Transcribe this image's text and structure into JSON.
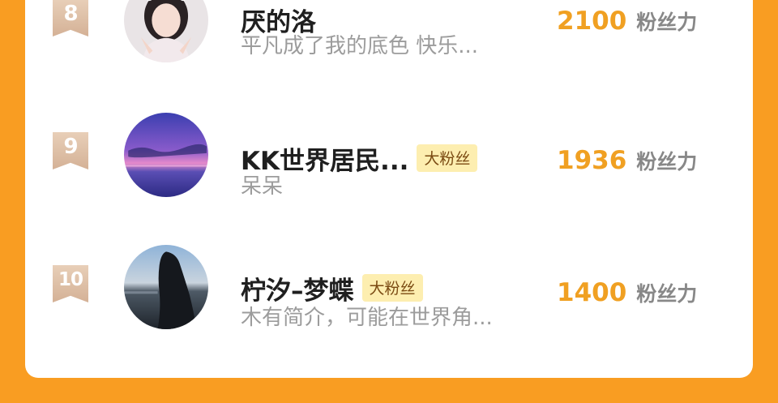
{
  "ranking": {
    "entries": [
      {
        "rank": "8",
        "name": "厌的洛",
        "badge": "",
        "bio": "平凡成了我的底色 快乐...",
        "score": "2100",
        "score_unit": "粉丝力",
        "avatar_icon": "girl-portrait-avatar"
      },
      {
        "rank": "9",
        "name": "KK世界居民...",
        "badge": "大粉丝",
        "bio": "呆呆",
        "score": "1936",
        "score_unit": "粉丝力",
        "avatar_icon": "purple-sunset-sea-avatar"
      },
      {
        "rank": "10",
        "name": "柠汐–梦蝶",
        "badge": "大粉丝",
        "bio": "木有简介，可能在世界角...",
        "score": "1400",
        "score_unit": "粉丝力",
        "avatar_icon": "silhouette-beach-avatar"
      }
    ]
  },
  "colors": {
    "background_orange": "#F99D22",
    "score_orange": "#F0A022",
    "badge_bg": "#FDEEB0",
    "rank_ribbon": "#D9B79E"
  }
}
